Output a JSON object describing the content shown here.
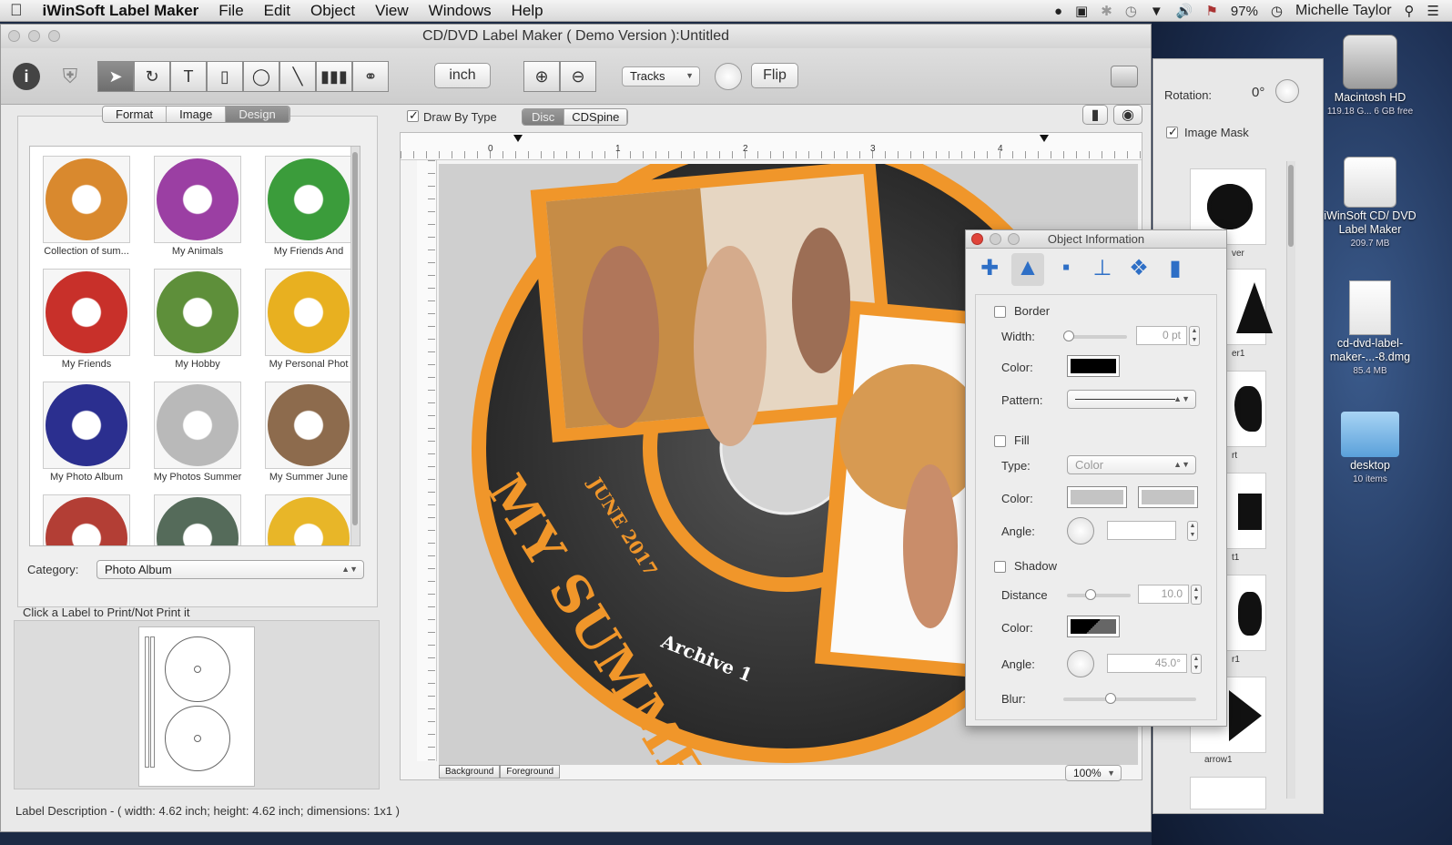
{
  "menubar": {
    "app_name": "iWinSoft Label Maker",
    "items": [
      "File",
      "Edit",
      "Object",
      "View",
      "Windows",
      "Help"
    ],
    "battery": "97%",
    "user": "Michelle Taylor"
  },
  "window": {
    "title": "CD/DVD Label Maker ( Demo Version ):Untitled"
  },
  "toolbar": {
    "unit_label": "inch",
    "tracks_label": "Tracks",
    "flip_label": "Flip"
  },
  "left_panel": {
    "tabs": [
      "Format",
      "Image",
      "Design"
    ],
    "selected_tab": "Design",
    "thumbnails": [
      {
        "label": "Collection of sum...",
        "color": "#d9892e"
      },
      {
        "label": "My Animals",
        "color": "#9b3fa3"
      },
      {
        "label": "My Friends And",
        "color": "#3b9c3b"
      },
      {
        "label": "My Friends",
        "color": "#c8302a"
      },
      {
        "label": "My Hobby",
        "color": "#5e8f3a"
      },
      {
        "label": "My Personal Phot",
        "color": "#e8b020"
      },
      {
        "label": "My Photo Album",
        "color": "#2b2f8f"
      },
      {
        "label": "My Photos Summer",
        "color": "#b9b9b9"
      },
      {
        "label": "My Summer June",
        "color": "#8d6b4d"
      },
      {
        "label": "",
        "color": "#b33e35"
      },
      {
        "label": "",
        "color": "#556b5a"
      },
      {
        "label": "",
        "color": "#e8b628"
      }
    ],
    "category_label": "Category:",
    "category_value": "Photo Album",
    "print_hint": "Click a Label to Print/Not Print it"
  },
  "canvas": {
    "draw_by_type_label": "Draw By Type",
    "type_tabs": [
      "Disc",
      "CDSpine"
    ],
    "ruler_marks": [
      "0",
      "1",
      "2",
      "3",
      "4"
    ],
    "bottom_tabs": [
      "Background",
      "Foreground"
    ],
    "zoom": "100%",
    "disc_text": {
      "date": "JUNE 2017",
      "title": "MY SUMMER",
      "subtitle": "Archive 1"
    }
  },
  "status": {
    "label_description": "Label Description - ( width: 4.62 inch; height: 4.62 inch; dimensions: 1x1 )"
  },
  "object_info": {
    "title": "Object Information",
    "border_label": "Border",
    "width_label": "Width:",
    "width_value": "0 pt",
    "color_label": "Color:",
    "pattern_label": "Pattern:",
    "fill_label": "Fill",
    "type_label": "Type:",
    "type_value": "Color",
    "fill_color_label": "Color:",
    "angle_label": "Angle:",
    "shadow_label": "Shadow",
    "distance_label": "Distance",
    "distance_value": "10.0",
    "shadow_color_label": "Color:",
    "shadow_angle_label": "Angle:",
    "shadow_angle_value": "45.0°",
    "blur_label": "Blur:"
  },
  "right_panel": {
    "rotation_label": "Rotation:",
    "rotation_value": "0°",
    "image_mask_label": "Image Mask",
    "mask_captions": [
      "ver",
      "er1",
      "rt",
      "t1",
      "r1",
      "arrow1"
    ]
  },
  "desktop": {
    "icons": [
      {
        "name": "Macintosh HD",
        "sub": "119.18 G... 6 GB free"
      },
      {
        "name": "iWinSoft CD/ DVD Label Maker",
        "sub": "209.7 MB"
      },
      {
        "name": "cd-dvd-label-maker-...-8.dmg",
        "sub": "85.4 MB"
      },
      {
        "name": "desktop",
        "sub": "10 items"
      }
    ]
  }
}
